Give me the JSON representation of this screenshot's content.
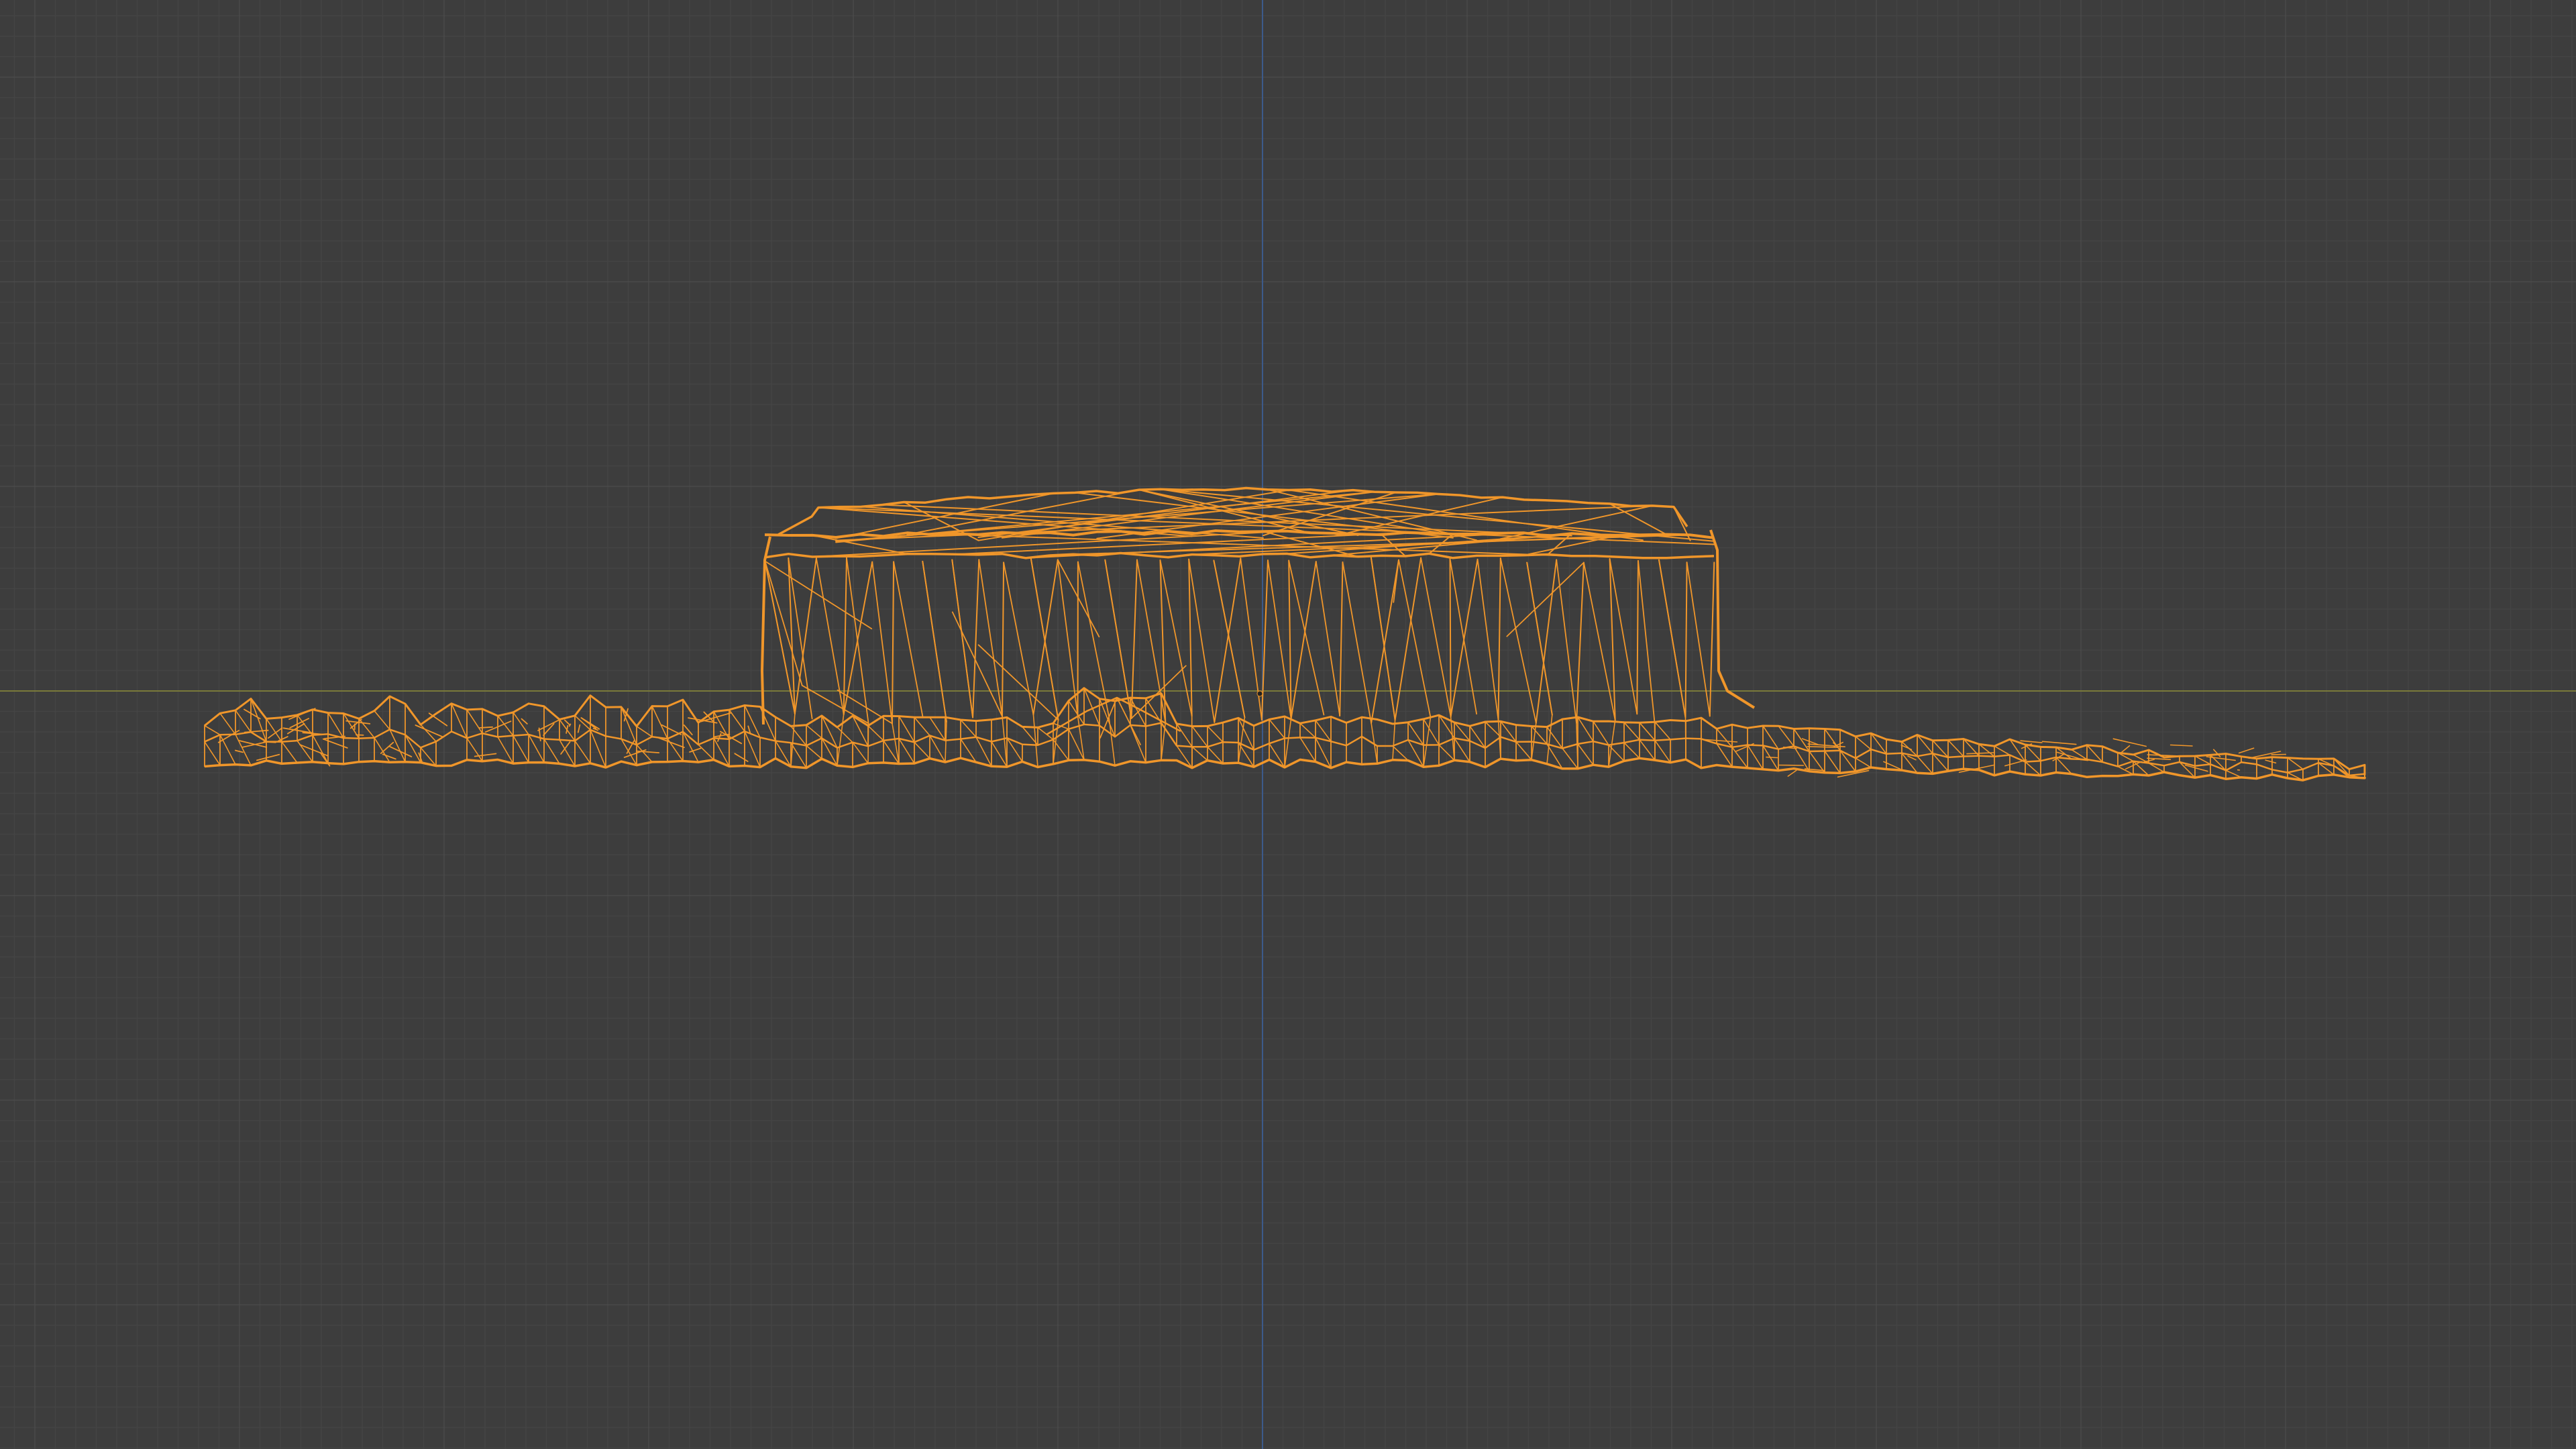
{
  "viewport": {
    "view": "orthographic-front",
    "shading": "wireframe",
    "grid": true,
    "object_selected": true
  },
  "colors": {
    "background": "#3d3d3d",
    "grid_minor": "#444444",
    "grid_major": "#4a4a4a",
    "axis_x": "#7a7a3a",
    "axis_z": "#3c5a8a",
    "wire_selected": "#f0962a",
    "wire_dim": "#c0741c"
  },
  "icons": {
    "object_origin": "origin-dot-icon"
  }
}
